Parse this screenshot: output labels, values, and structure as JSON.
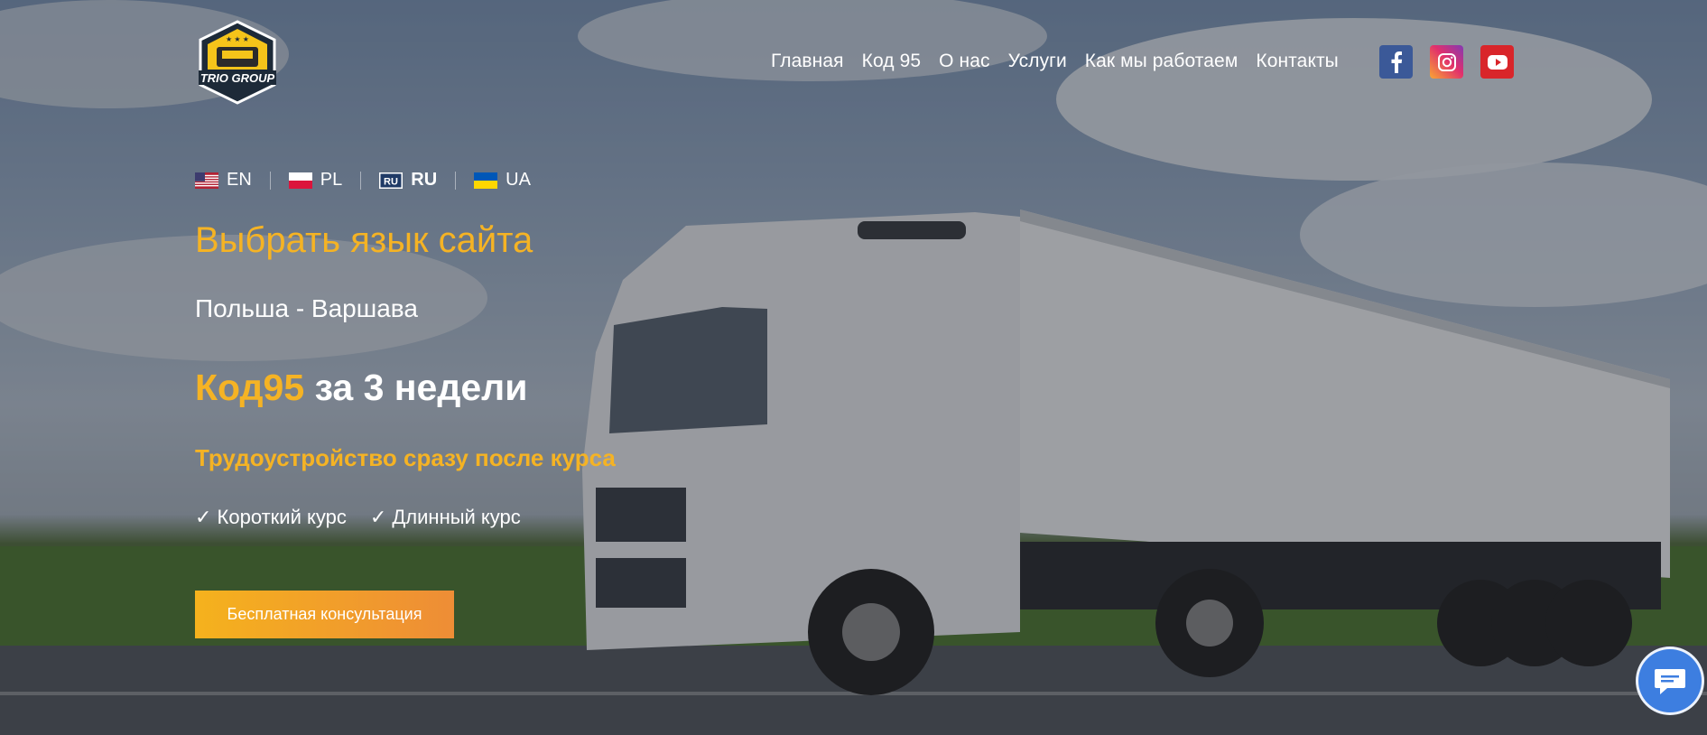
{
  "brand": {
    "logo_text": "TRIO GROUP",
    "colors": {
      "accent": "#f5b324",
      "cta_start": "#f5b21d",
      "cta_end": "#ee8d36"
    }
  },
  "nav": {
    "items": [
      "Главная",
      "Код 95",
      "О нас",
      "Услуги",
      "Как мы работаем",
      "Контакты"
    ]
  },
  "social": [
    {
      "name": "facebook",
      "icon": "facebook-icon"
    },
    {
      "name": "instagram",
      "icon": "instagram-icon"
    },
    {
      "name": "youtube",
      "icon": "youtube-icon"
    }
  ],
  "languages": [
    {
      "code": "EN",
      "flag": "us-flag-icon",
      "active": false
    },
    {
      "code": "PL",
      "flag": "pl-flag-icon",
      "active": false
    },
    {
      "code": "RU",
      "flag": "ru-flag-icon",
      "active": true
    },
    {
      "code": "UA",
      "flag": "ua-flag-icon",
      "active": false
    }
  ],
  "hero": {
    "choose_language": "Выбрать язык сайта",
    "location": "Польша - Варшава",
    "headline_accent": "Код95",
    "headline_rest": " за 3 недели",
    "subheadline": "Трудоустройство сразу после курса",
    "courses": [
      "✓ Короткий курс",
      "✓ Длинный курс"
    ],
    "cta_label": "Бесплатная консультация"
  },
  "chat": {
    "icon": "chat-bubble-icon"
  }
}
